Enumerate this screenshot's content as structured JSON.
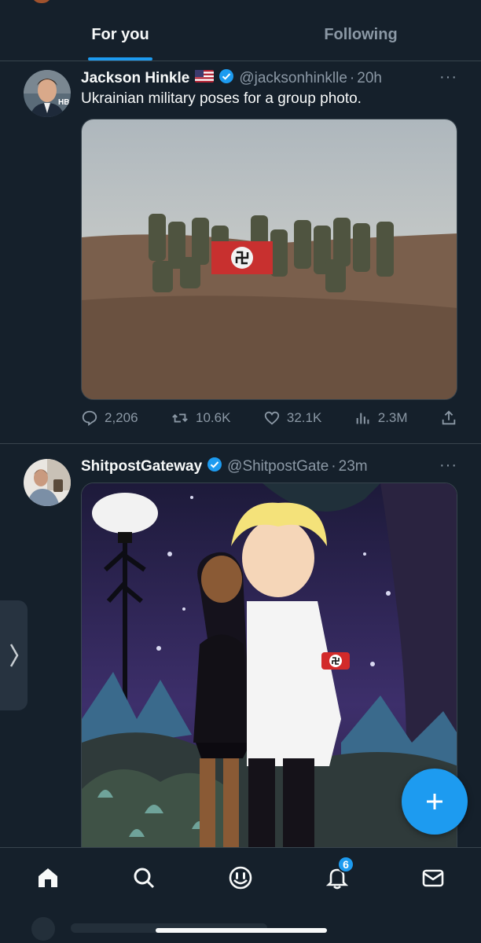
{
  "tabs": [
    {
      "label": "For you",
      "active": true
    },
    {
      "label": "Following",
      "active": false
    }
  ],
  "posts": [
    {
      "author": "Jackson Hinkle",
      "flag_icon": "us-flag-icon",
      "verified": true,
      "handle": "@jacksonhinklle",
      "time": "20h",
      "text": "Ukrainian military poses for a group photo.",
      "media": "photo of soldiers in fog posing with flag",
      "stats": {
        "replies": "2,206",
        "reposts": "10.6K",
        "likes": "32.1K",
        "views": "2.3M"
      }
    },
    {
      "author": "ShitpostGateway",
      "verified": true,
      "handle": "@ShitpostGate",
      "time": "23m",
      "media": "cartoon illustration of two characters at night"
    }
  ],
  "dot_separator": "·",
  "more_label": "···",
  "notifications_badge": "6",
  "colors": {
    "background": "#15202b",
    "accent": "#1d9bf0",
    "border": "#38444d",
    "secondary_text": "#8b98a5"
  },
  "nav_icons": [
    "home-icon",
    "search-icon",
    "grok-icon",
    "notifications-icon",
    "messages-icon"
  ]
}
